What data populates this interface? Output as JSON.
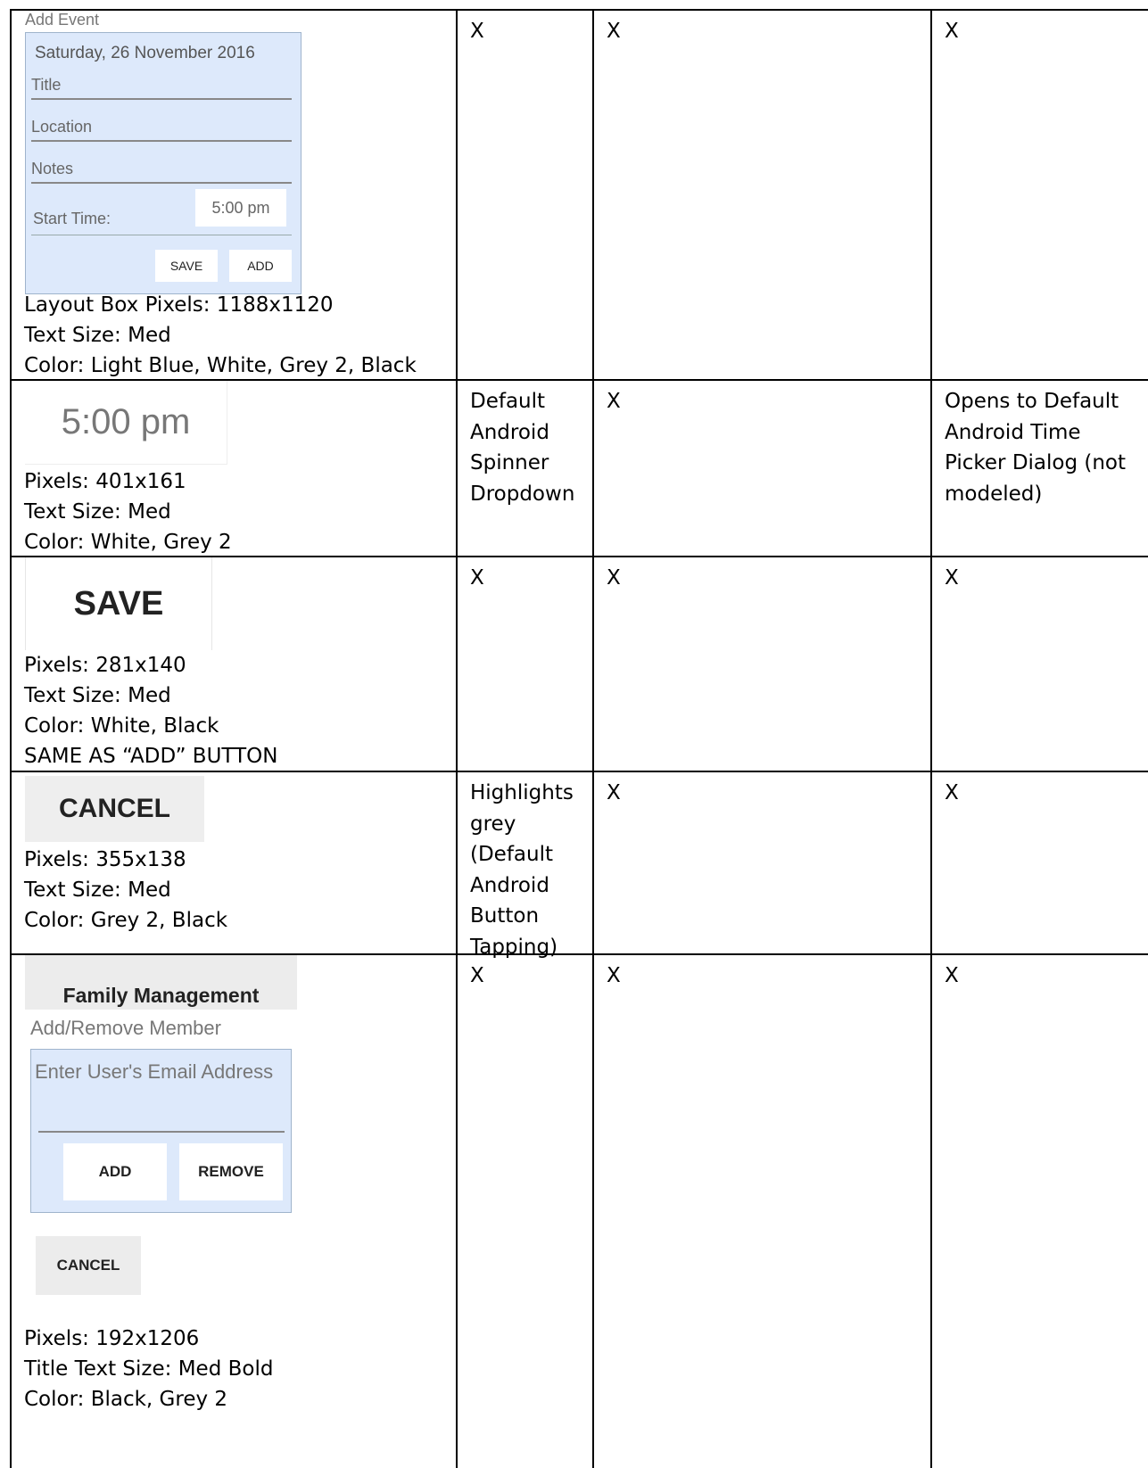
{
  "rows": [
    {
      "mock": {
        "title": "Add Event",
        "date": "Saturday, 26 November 2016",
        "fields": [
          "Title",
          "Location",
          "Notes"
        ],
        "start_time_label": "Start Time:",
        "start_time_value": "5:00 pm",
        "save": "SAVE",
        "add": "ADD"
      },
      "meta": [
        "Layout Box Pixels: 1188x1120",
        "Text Size: Med",
        "Color: Light Blue, White, Grey 2, Black"
      ],
      "c2": "X",
      "c3": "X",
      "c4": "X"
    },
    {
      "mock": {
        "value": "5:00 pm"
      },
      "meta": [
        "Pixels: 401x161",
        "Text Size: Med",
        "Color: White, Grey 2"
      ],
      "c2": "Default Android Spinner Dropdown",
      "c3": "X",
      "c4": "Opens to Default Android Time Picker Dialog (not modeled)"
    },
    {
      "mock": {
        "label": "SAVE"
      },
      "meta": [
        "Pixels: 281x140",
        "Text Size: Med",
        "Color: White, Black",
        "SAME AS “ADD” BUTTON"
      ],
      "c2": "X",
      "c3": "X",
      "c4": "X"
    },
    {
      "mock": {
        "label": "CANCEL"
      },
      "meta": [
        "Pixels: 355x138",
        "Text Size: Med",
        "Color: Grey 2, Black"
      ],
      "c2": "Highlights grey (Default Android Button Tapping)",
      "c3": "X",
      "c4": "X"
    },
    {
      "mock": {
        "title": "Family Management",
        "subtitle": "Add/Remove Member",
        "email_placeholder": "Enter User's Email Address",
        "add": "ADD",
        "remove": "REMOVE",
        "cancel": "CANCEL"
      },
      "meta": [
        "Pixels: 192x1206",
        "Title Text Size: Med Bold",
        "Color: Black, Grey 2"
      ],
      "c2": "X",
      "c3": "X",
      "c4": "X"
    }
  ]
}
